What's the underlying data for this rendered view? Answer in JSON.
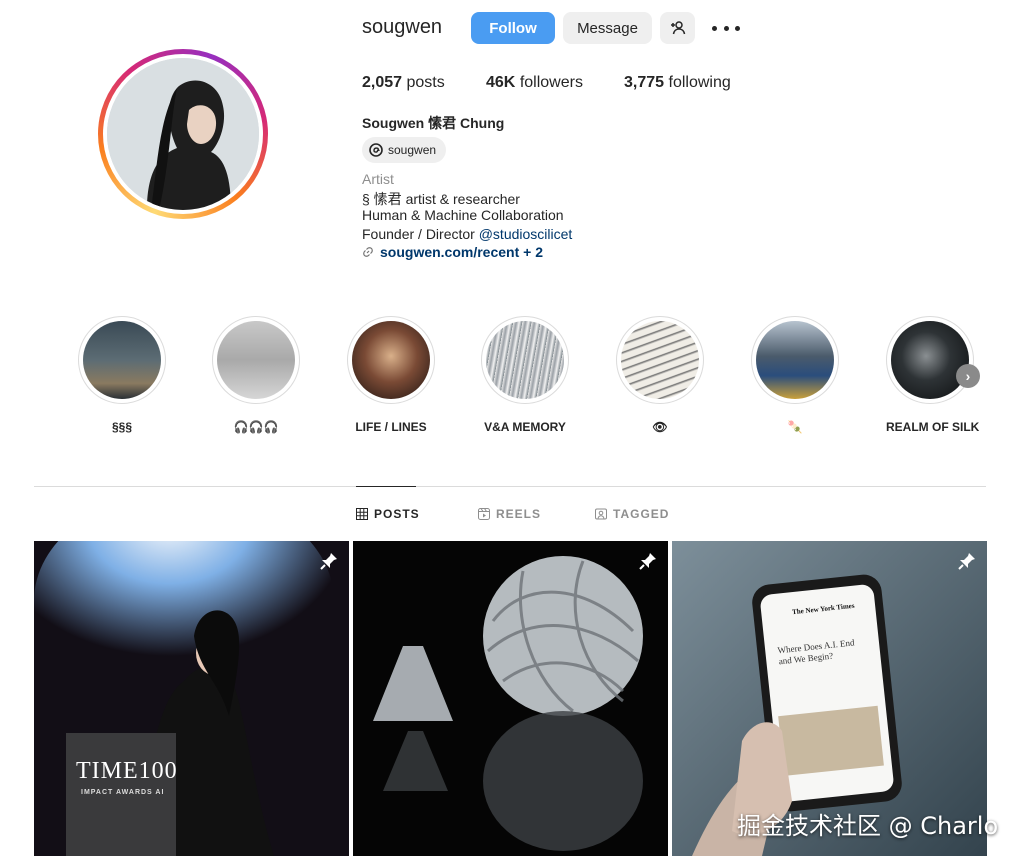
{
  "profile": {
    "username": "sougwen",
    "follow_label": "Follow",
    "message_label": "Message",
    "stats": {
      "posts_count": "2,057",
      "posts_label": "posts",
      "followers_count": "46K",
      "followers_label": "followers",
      "following_count": "3,775",
      "following_label": "following"
    },
    "full_name": "Sougwen 愫君 Chung",
    "threads_handle": "sougwen",
    "category": "Artist",
    "bio_line1": "§ 愫君 artist & researcher",
    "bio_line2": "Human & Machine Collaboration",
    "bio_line3_prefix": "Founder / Director ",
    "bio_mention": "@studioscilicet",
    "link_text": "sougwen.com/recent + 2"
  },
  "highlights": [
    {
      "label": "§§§"
    },
    {
      "label": "🎧🎧🎧"
    },
    {
      "label": "LIFE / LINES"
    },
    {
      "label": "V&A MEMORY"
    },
    {
      "label": "👁"
    },
    {
      "label": "🍡"
    },
    {
      "label": "REALM OF SILK"
    }
  ],
  "tabs": [
    {
      "label": "POSTS",
      "icon": "grid-icon",
      "active": true
    },
    {
      "label": "REELS",
      "icon": "reels-icon",
      "active": false
    },
    {
      "label": "TAGGED",
      "icon": "tagged-icon",
      "active": false
    }
  ],
  "posts": [
    {
      "overlay_text": "TIME100",
      "overlay_sub": "IMPACT AWARDS AI",
      "pinned": true
    },
    {
      "pinned": true
    },
    {
      "overlay_text": "The New York Times",
      "overlay_sub": "Where Does A.I. End and We Begin?",
      "pinned": true
    }
  ],
  "watermark": "掘金技术社区 @ Charlo",
  "colors": {
    "follow_blue": "#4a9cf2",
    "link_blue": "#00376b",
    "secondary_text": "#8e8e8e"
  }
}
